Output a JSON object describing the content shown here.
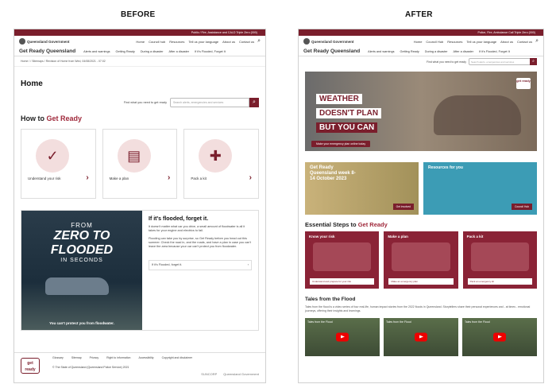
{
  "labels": {
    "before": "BEFORE",
    "after": "AFTER"
  },
  "colors": {
    "brand": "#7a1e2c",
    "accent": "#a0293b",
    "promo_blue": "#3c9cb5"
  },
  "before": {
    "topbar": "Public / Fire, Assistance and CALD Triple Zero (000)",
    "logo": "Queensland Government",
    "util_links": [
      "Home",
      "Council hub",
      "Resources",
      "Tell us your language",
      "About us",
      "Contact us"
    ],
    "brand": "Get Ready Queensland",
    "nav": [
      "Alerts and warnings",
      "Getting Ready",
      "During a disaster",
      "After a disaster",
      "If it's Flooded, Forget It"
    ],
    "breadcrumb": "Home / / Sitemaps / Revision of Home from Wed, 04/08/2021 - 07:02",
    "page_title": "Home",
    "search_label": "Find what you need to get ready",
    "search_placeholder": "Search alerts, emergencies and services",
    "section_title_a": "How to ",
    "section_title_b": "Get Ready",
    "cards": [
      {
        "label": "Understand your risk",
        "icon": "chat-check-icon"
      },
      {
        "label": "Make a plan",
        "icon": "clipboard-check-icon"
      },
      {
        "label": "Pack a kit",
        "icon": "emergency-kit-icon"
      }
    ],
    "flood": {
      "line1": "FROM",
      "line2": "ZERO TO",
      "line3": "FLOODED",
      "line4": "IN SECONDS",
      "caption": "You can't protect you from floodwater.",
      "title": "If it's flooded, forget it.",
      "p1": "It doesn't matter what car you drive, a small amount of floodwater is all it takes for your engine and electrics to fail.",
      "p2": "Flooding can take you by surprise, so Get Ready before you head out this summer. Check the road in, and the roads, and have a plan in case you can't leave the area because your car can't protect you from floodwater.",
      "link": "If it's Flooded, forget it."
    },
    "footer": {
      "badge": "get ready",
      "links": [
        "Glossary",
        "Sitemap",
        "Privacy",
        "Right to information",
        "Accessibility",
        "Copyright and disclaimer"
      ],
      "copy": "© The State of Queensland (Queensland Police Service) 2021",
      "logos": [
        "SUNCORP",
        "Queensland Government"
      ]
    }
  },
  "after": {
    "topbar": "Police, Fire, Ambulance Call Triple Zero (000)",
    "logo": "Queensland Government",
    "util_links": [
      "Home",
      "Council Hub",
      "Resources",
      "Tell us your language",
      "About us",
      "Contact us"
    ],
    "brand": "Get Ready Queensland",
    "nav": [
      "Alerts and warnings",
      "Getting Ready",
      "During a disaster",
      "After a disaster",
      "If it's Flooded, Forget It"
    ],
    "search_label": "Find what you need to get ready",
    "search_placeholder": "Search alerts, emergencies and services",
    "hero": {
      "line1a": "WEATHER",
      "line1b": "DOESN'T PLAN",
      "line2": "BUT YOU CAN",
      "badge": "get ready",
      "cta": "Make your emergency plan online today"
    },
    "promos": [
      {
        "title": "Get Ready Queensland week 8-14 October 2023",
        "button": "Get involved"
      },
      {
        "title": "Resources for you",
        "button": "Council Hub"
      }
    ],
    "steps_title_a": "Essential Steps to ",
    "steps_title_b": "Get Ready",
    "steps": [
      {
        "title": "Know your risk",
        "button": "Understand and prepare for your risk"
      },
      {
        "title": "Make a plan",
        "button": "Make an emergency plan"
      },
      {
        "title": "Pack a kit",
        "button": "Pack an emergency kit"
      }
    ],
    "tales_title": "Tales from the Flood",
    "tales_text": "Tales from the flood is a video series of four real-life, human impact stories from the 2022 floods in Queensland. Storytellers share their personal experiences and - at times - emotional journeys, offering their insights and learnings.",
    "videos": [
      {
        "title": "Tales from the Flood"
      },
      {
        "title": "Tales from the Flood"
      },
      {
        "title": "Tales from the Flood"
      }
    ]
  }
}
